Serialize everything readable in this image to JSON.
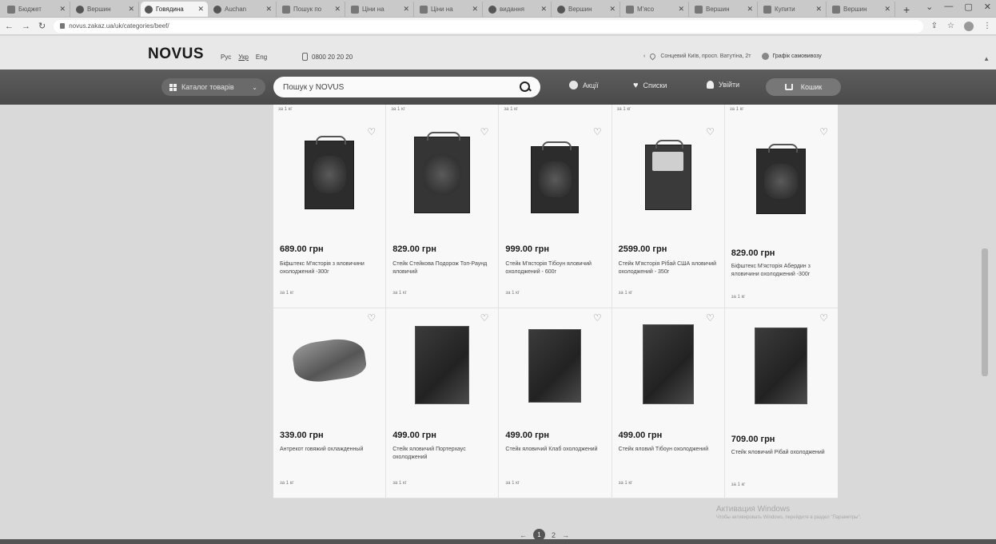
{
  "browser": {
    "tabs": [
      {
        "label": "Бюджет"
      },
      {
        "label": "Вершин"
      },
      {
        "label": "Говядина",
        "active": true
      },
      {
        "label": "Auchan"
      },
      {
        "label": "Пошук по"
      },
      {
        "label": "Ціни на"
      },
      {
        "label": "Ціни на"
      },
      {
        "label": "видання"
      },
      {
        "label": "Вершин"
      },
      {
        "label": "М'ясо"
      },
      {
        "label": "Вершин"
      },
      {
        "label": "Купити"
      },
      {
        "label": "Вершин"
      }
    ],
    "url": "novus.zakaz.ua/uk/categories/beef/"
  },
  "site": {
    "logo": "NOVUS",
    "lang_ru": "Рус",
    "lang_uk": "Укр",
    "lang_en": "Eng",
    "phone": "0800 20 20 20",
    "address": "Сонцевий Київ, просп. Ватутіна, 2т",
    "schedule": "Графік самовивозу"
  },
  "nav": {
    "catalog": "Каталог товарів",
    "search_placeholder": "Пошук у NOVUS",
    "promo": "Акції",
    "lists": "Списки",
    "login": "Увійти",
    "cart": "Кошик"
  },
  "top_units": [
    "за 1 кг",
    "за 1 кг",
    "за 1 кг",
    "за 1 кг",
    "за 1 кг"
  ],
  "products": [
    {
      "price": "689.00 грн",
      "name": "Біфштекс М'ясторія з яловичини охолоджений -300г",
      "unit": "за 1 кг"
    },
    {
      "price": "829.00 грн",
      "name": "Стейк Стейкова Подорож Топ-Раунд яловичий",
      "unit": "за 1 кг"
    },
    {
      "price": "999.00 грн",
      "name": "Стейк М'ясторія Тібоун яловичий охолоджений - 600г",
      "unit": "за 1 кг"
    },
    {
      "price": "2599.00 грн",
      "name": "Стейк М'ясторія Рібай США яловичий охолоджений - 350г",
      "unit": "за 1 кг"
    },
    {
      "price": "829.00 грн",
      "name": "Біфштекс М'ясторія Абердин з яловичини охолоджений -300г",
      "unit": "за 1 кг"
    },
    {
      "price": "339.00 грн",
      "name": "Антрекот говяжий охлажденный",
      "unit": "за 1 кг"
    },
    {
      "price": "499.00 грн",
      "name": "Стейк яловичий Портерхаус охолоджений",
      "unit": "за 1 кг"
    },
    {
      "price": "499.00 грн",
      "name": "Стейк яловичий Клаб охолоджений",
      "unit": "за 1 кг"
    },
    {
      "price": "499.00 грн",
      "name": "Стейк яловий Тібоун охолоджений",
      "unit": "за 1 кг"
    },
    {
      "price": "709.00 грн",
      "name": "Стейк яловичий Рібай охолоджений",
      "unit": "за 1 кг"
    }
  ],
  "pagination": {
    "prev": "←",
    "current": "1",
    "next_page": "2",
    "next": "→"
  },
  "watermark": {
    "title": "Активация Windows",
    "subtitle": "Чтобы активировать Windows, перейдите в раздел \"Параметры\"."
  }
}
